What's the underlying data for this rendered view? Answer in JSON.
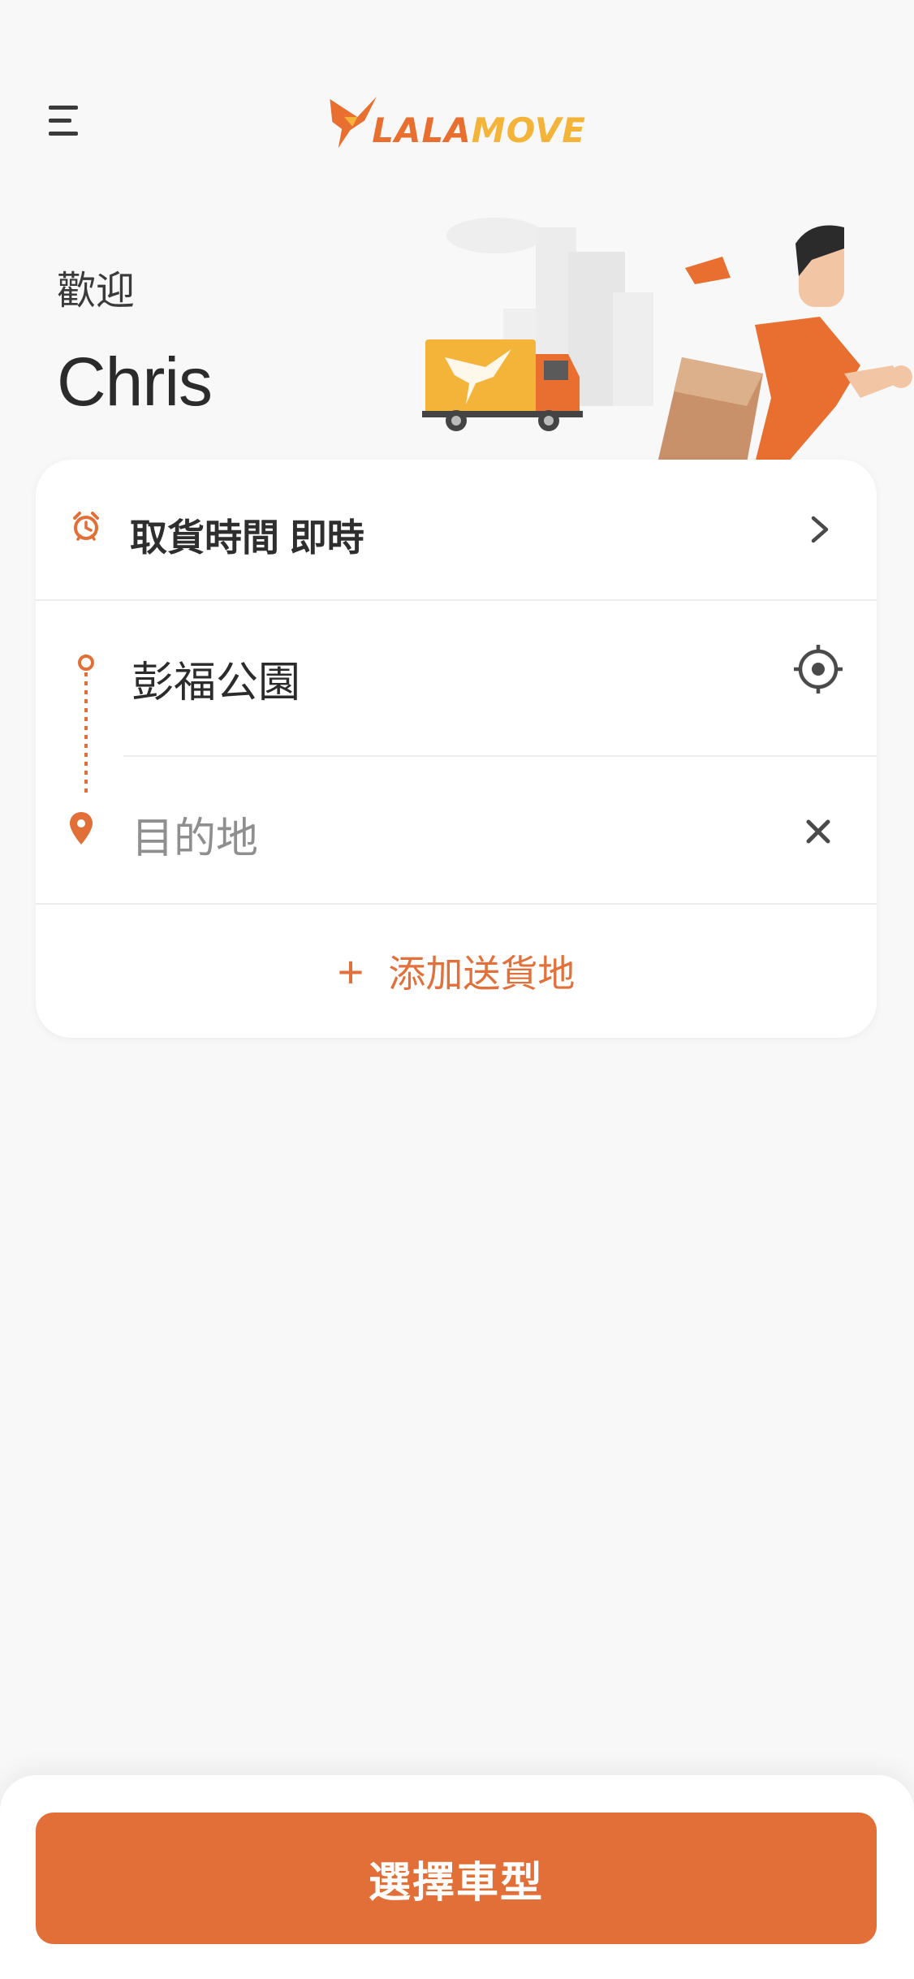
{
  "header": {
    "logo_text_primary": "LALA",
    "logo_text_secondary": "MOVE"
  },
  "welcome": {
    "greeting": "歡迎",
    "name": "Chris"
  },
  "order_card": {
    "pickup_time_label": "取貨時間 即時",
    "pickup_location": "彭福公園",
    "destination_placeholder": "目的地",
    "add_stop_label": "添加送貨地"
  },
  "footer": {
    "cta_label": "選擇車型"
  },
  "icons": {
    "menu": "menu-icon",
    "alarm": "alarm-clock-icon",
    "chevron": "chevron-right-icon",
    "target": "locate-target-icon",
    "clear": "close-icon",
    "pin": "location-pin-icon",
    "plus": "plus-icon"
  },
  "colors": {
    "accent": "#e26f37",
    "logo_orange": "#e86f2f",
    "logo_yellow": "#f4b43a",
    "background": "#f8f8f8"
  }
}
